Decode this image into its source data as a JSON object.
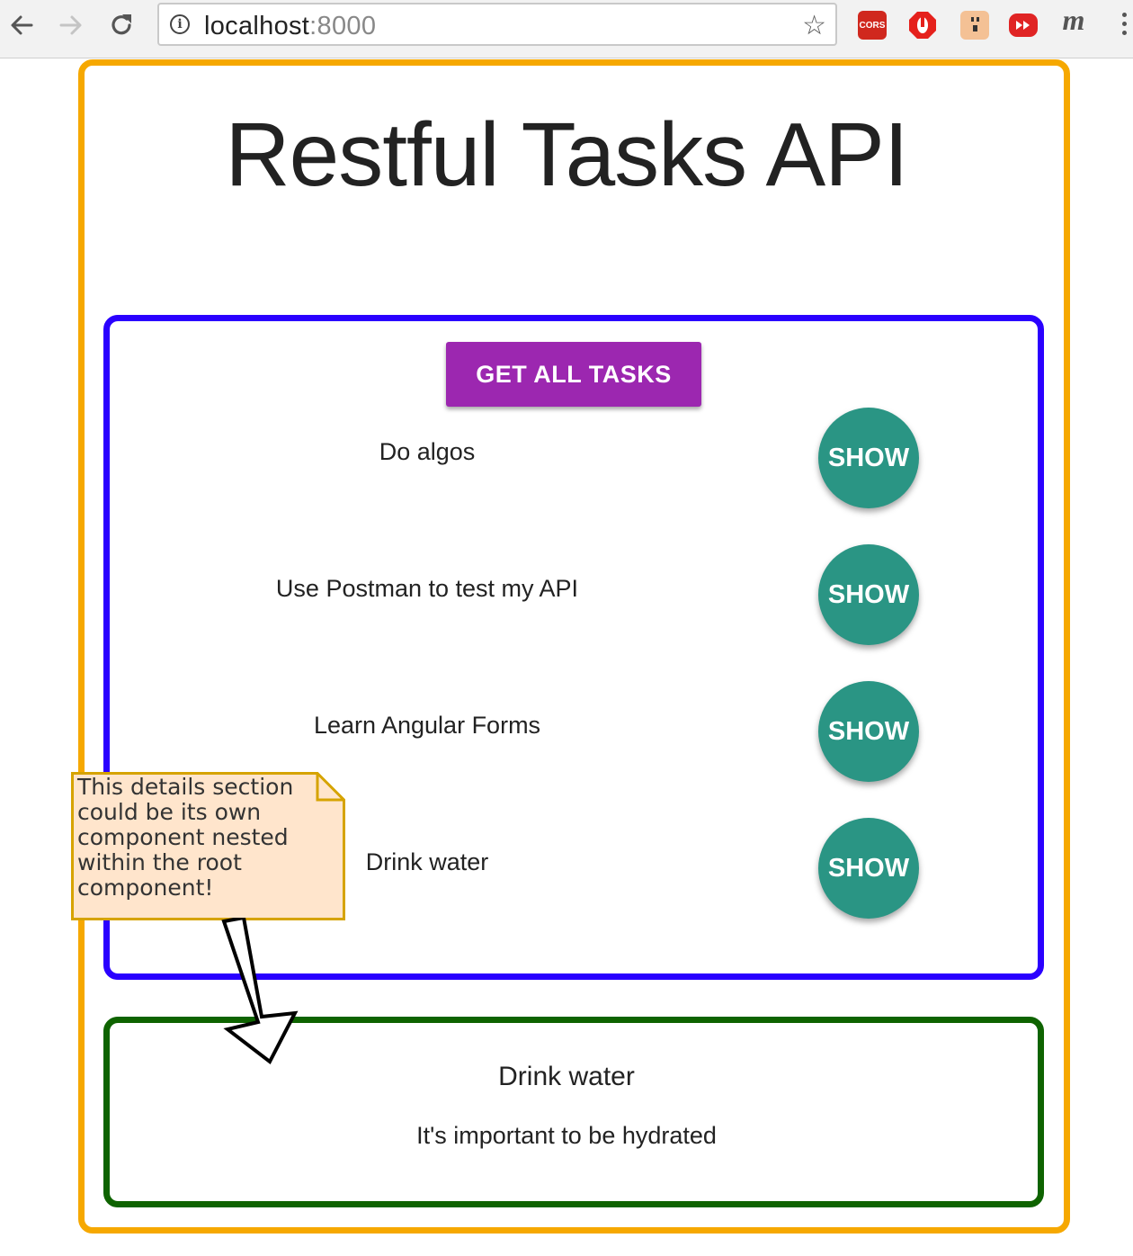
{
  "browser": {
    "url_host": "localhost",
    "url_port": ":8000",
    "extensions": [
      "cors-extension-icon",
      "adblock-icon",
      "puppet-extension-icon",
      "youtube-extension-icon",
      "m-extension-icon"
    ],
    "ext_cors_label": "CORS",
    "ext_m_label": "m"
  },
  "page": {
    "title": "Restful Tasks API",
    "get_all_label": "GET ALL TASKS",
    "tasks": [
      {
        "title": "Do algos",
        "button": "SHOW"
      },
      {
        "title": "Use Postman to test my API",
        "button": "SHOW"
      },
      {
        "title": "Learn Angular Forms",
        "button": "SHOW"
      },
      {
        "title": "Drink water",
        "button": "SHOW"
      }
    ],
    "detail": {
      "title": "Drink water",
      "description": "It's important to be hydrated"
    }
  },
  "annotation": {
    "lines": [
      "This details section",
      "could be its own",
      "component nested",
      "within the root",
      "component!"
    ]
  },
  "colors": {
    "root_border": "#f6a800",
    "list_border": "#2a00ff",
    "detail_border": "#0e6300",
    "primary_button": "#9c27b0",
    "show_button": "#2a9584",
    "note_fill": "#ffe5cc",
    "note_border": "#d6a300"
  }
}
